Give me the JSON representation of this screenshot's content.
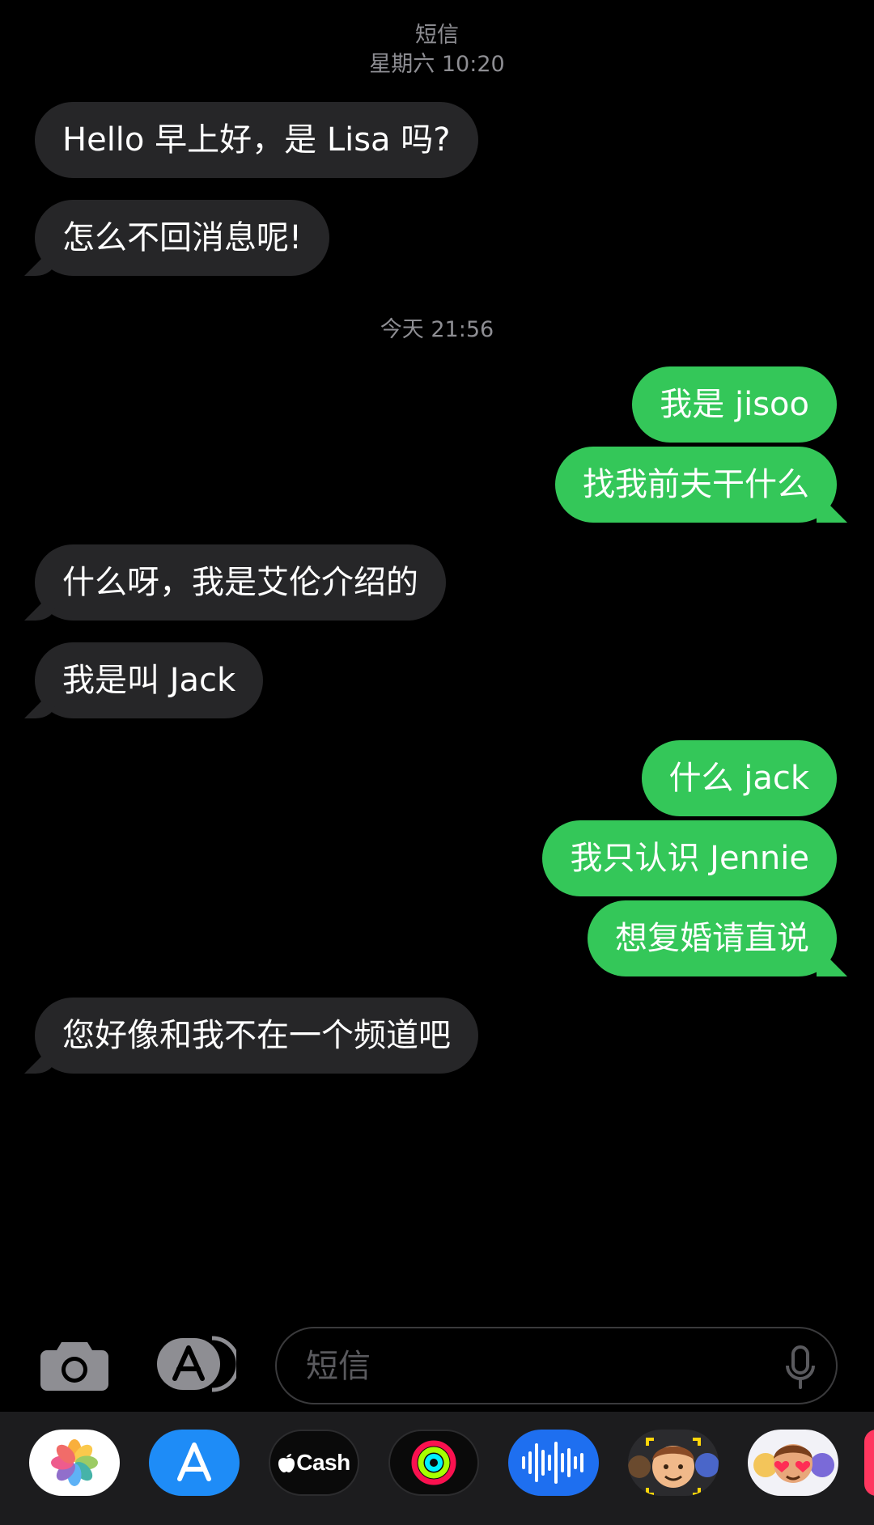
{
  "header": {
    "title": "短信",
    "timestamp": "星期六 10:20"
  },
  "divider_timestamp": "今天 21:56",
  "messages": [
    {
      "direction": "incoming",
      "text": "Hello 早上好，是 Lisa 吗?"
    },
    {
      "direction": "incoming",
      "text": "怎么不回消息呢!"
    },
    {
      "direction": "outgoing",
      "text": "我是 jisoo"
    },
    {
      "direction": "outgoing",
      "text": "找我前夫干什么"
    },
    {
      "direction": "incoming",
      "text": "什么呀，我是艾伦介绍的"
    },
    {
      "direction": "incoming",
      "text": "我是叫 Jack"
    },
    {
      "direction": "outgoing",
      "text": "什么 jack"
    },
    {
      "direction": "outgoing",
      "text": "我只认识 Jennie"
    },
    {
      "direction": "outgoing",
      "text": "想复婚请直说"
    },
    {
      "direction": "incoming",
      "text": "您好像和我不在一个频道吧"
    }
  ],
  "input": {
    "placeholder": "短信",
    "value": ""
  },
  "app_drawer": {
    "apps": [
      {
        "name": "photos-icon"
      },
      {
        "name": "app-store-icon"
      },
      {
        "name": "apple-cash-icon",
        "label": "Cash"
      },
      {
        "name": "activity-icon"
      },
      {
        "name": "audio-message-icon"
      },
      {
        "name": "memoji-icon"
      },
      {
        "name": "memoji-stickers-icon"
      }
    ]
  },
  "colors": {
    "background": "#000000",
    "incoming_bubble": "#262628",
    "outgoing_bubble": "#34c759",
    "secondary_text": "#8e8e93",
    "drawer_background": "#1c1c1e",
    "app_store_blue": "#1e8cf7"
  }
}
